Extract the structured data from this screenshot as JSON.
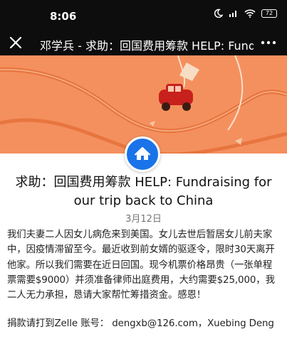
{
  "status_bar": {
    "time": "8:06",
    "battery": "72",
    "icons": [
      "moon-icon",
      "signal-icon",
      "wifi-icon",
      "battery-icon"
    ]
  },
  "header": {
    "title": "邓学兵 - 求助：回国费用筹款 HELP: Fundraising for our trip back to China",
    "close_icon": "close-icon",
    "more_icon": "more-icon"
  },
  "post": {
    "title": "求助：回国费用筹款 HELP: Fundraising for our trip back to China",
    "date": "3月12日",
    "body": "我们夫妻二人因女儿病危来到美国。女儿去世后暂居女儿前夫家中，因疫情滞留至今。最近收到前女婿的驱逐令，限时30天离开他家。所以我们需要在近日回国。现今机票价格昂贵（一张单程票需要$9000）并须准备律师出庭费用，大约需要$25,000，我二人无力承担，恳请大家帮忙筹措资金。感恩！",
    "payment": "捐款请打到Zelle 账号： dengxb@126.com，Xuebing Deng"
  },
  "colors": {
    "banner": "#f4905e",
    "avatar": "#1a73e8",
    "topbar": "#0d0d0d"
  }
}
